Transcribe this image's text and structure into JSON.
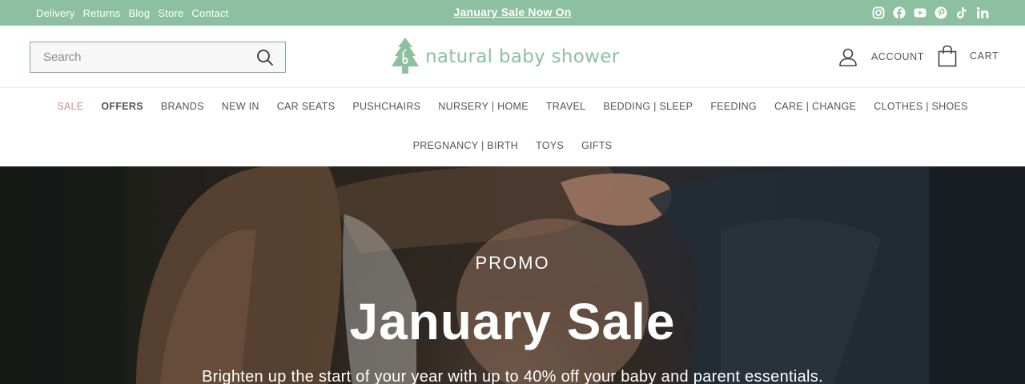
{
  "topbar": {
    "links": [
      "Delivery",
      "Returns",
      "Blog",
      "Store",
      "Contact"
    ],
    "announcement": "January Sale Now On",
    "social_icons": [
      "instagram-icon",
      "facebook-icon",
      "youtube-icon",
      "pinterest-icon",
      "tiktok-icon",
      "linkedin-icon"
    ],
    "background": "#8dc0a0"
  },
  "header": {
    "search_placeholder": "Search",
    "logo_text": "natural baby shower",
    "account_label": "ACCOUNT",
    "cart_label": "CART",
    "brand_color": "#8dc0a0"
  },
  "nav": {
    "row1": [
      "SALE",
      "OFFERS",
      "BRANDS",
      "NEW IN",
      "CAR SEATS",
      "PUSHCHAIRS",
      "NURSERY | HOME",
      "TRAVEL",
      "BEDDING | SLEEP",
      "FEEDING",
      "CARE | CHANGE",
      "CLOTHES | SHOES"
    ],
    "row2": [
      "PREGNANCY | BIRTH",
      "TOYS",
      "GIFTS"
    ],
    "sale_color": "#d98b86"
  },
  "hero": {
    "eyebrow": "PROMO",
    "title": "January Sale",
    "subtitle": "Brighten up the start of your year with up to 40% off your baby and parent essentials."
  }
}
